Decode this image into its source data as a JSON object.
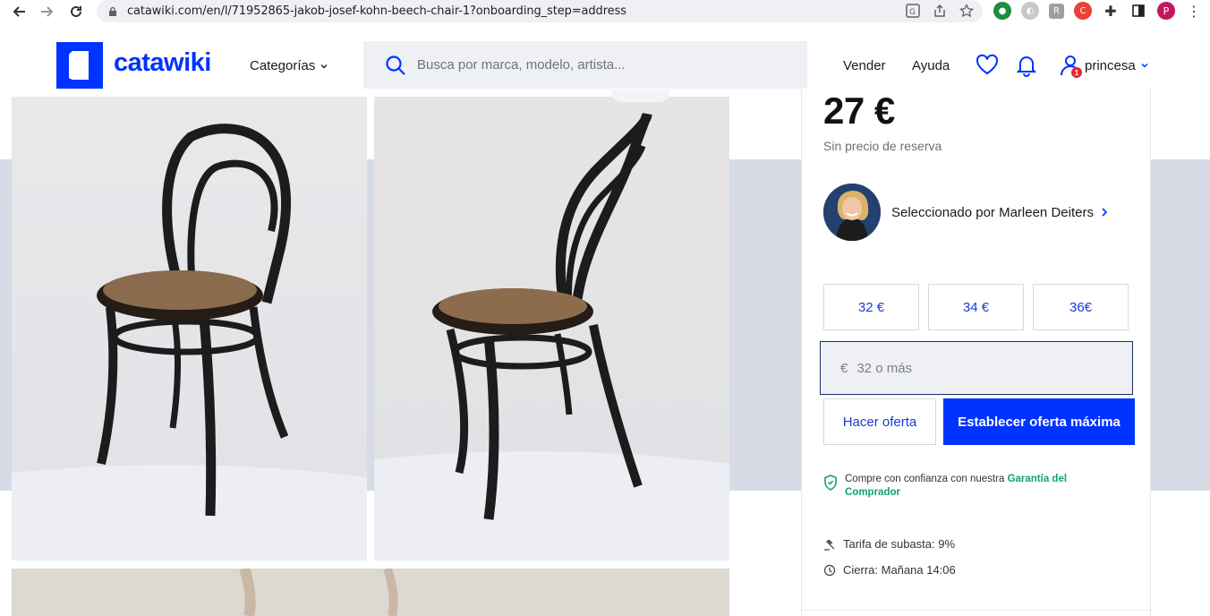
{
  "browser": {
    "url": "catawiki.com/en/l/71952865-jakob-josef-kohn-beech-chair-1?onboarding_step=address",
    "profile_initial": "P"
  },
  "header": {
    "logo_text": "catawiki",
    "categories_label": "Categorías",
    "search_placeholder": "Busca por marca, modelo, artista...",
    "sell_label": "Vender",
    "help_label": "Ayuda",
    "notification_count": "1",
    "username": "princesa"
  },
  "colors": {
    "brand": "#0033ff",
    "band": "#d6dbe6",
    "guarantee_link": "#12a07a"
  },
  "bid_panel": {
    "current_price": "27 €",
    "reserve_text": "Sin precio de reserva",
    "curator_text": "Seleccionado por Marleen Deiters",
    "quick_bids": [
      "32 €",
      "34 €",
      "36€"
    ],
    "currency_symbol": "€",
    "bid_placeholder": "32 o más",
    "offer_button": "Hacer oferta",
    "max_bid_button": "Establecer oferta máxima",
    "guarantee_text": "Compre con confianza con nuestra",
    "guarantee_link": "Garantía del Comprador",
    "fee_text": "Tarifa de subasta: 9%",
    "closes_text": "Cierra: Mañana 14:06"
  },
  "icons": [
    "back-arrow-icon",
    "forward-arrow-icon",
    "reload-icon",
    "lock-icon",
    "translate-icon",
    "share-icon",
    "bookmark-star-icon",
    "search-icon",
    "heart-icon",
    "bell-icon",
    "user-icon",
    "chevron-down-icon",
    "chevron-right-icon",
    "shield-icon",
    "gavel-icon",
    "clock-icon"
  ]
}
